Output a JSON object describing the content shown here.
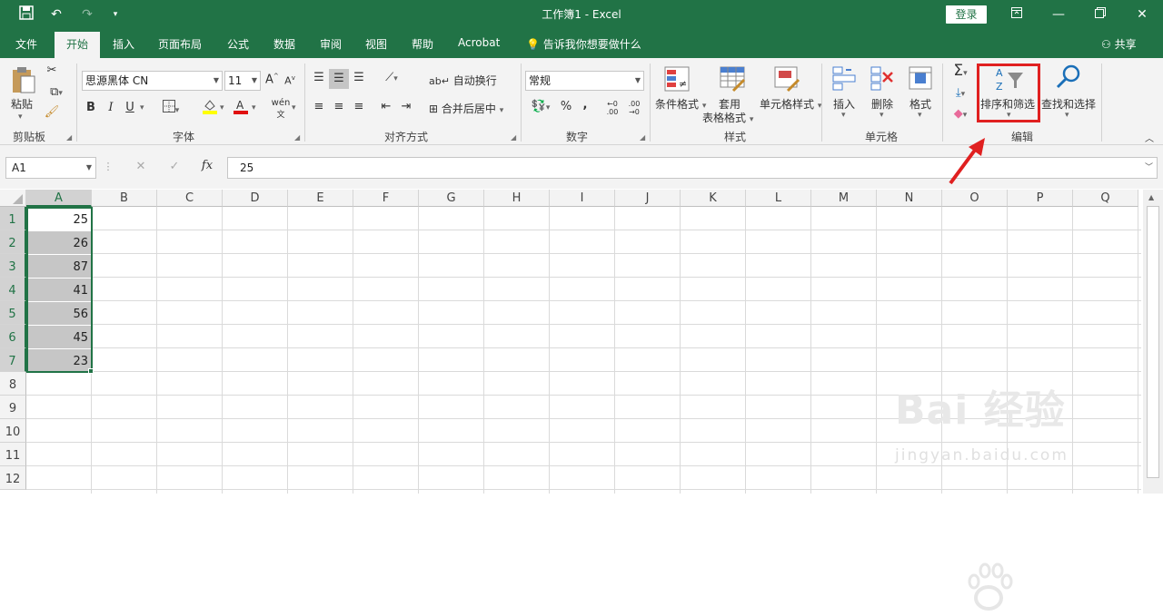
{
  "title": "工作簿1  -  Excel",
  "login": "登录",
  "qat": {
    "undo": "↶",
    "redo": "↷"
  },
  "tabs": [
    "文件",
    "开始",
    "插入",
    "页面布局",
    "公式",
    "数据",
    "审阅",
    "视图",
    "帮助",
    "Acrobat"
  ],
  "tell_me": "告诉我你想要做什么",
  "share": "共享",
  "clipboard": {
    "paste": "粘贴",
    "group": "剪贴板"
  },
  "font": {
    "name": "思源黑体 CN",
    "size": "11",
    "bold": "B",
    "italic": "I",
    "underline": "U",
    "group": "字体"
  },
  "alignment": {
    "wrap": "自动换行",
    "merge": "合并后居中",
    "group": "对齐方式"
  },
  "number": {
    "format": "常规",
    "percent": "%",
    "comma": ",",
    "group": "数字"
  },
  "styles": {
    "conditional": "条件格式",
    "table_line1": "套用",
    "table_line2": "表格格式",
    "cell_styles": "单元格样式",
    "group": "样式"
  },
  "cells": {
    "insert": "插入",
    "delete": "删除",
    "format": "格式",
    "group": "单元格"
  },
  "editing": {
    "sigma": "Σ",
    "sort_filter": "排序和筛选",
    "find_select": "查找和选择",
    "group": "编辑"
  },
  "formula": {
    "name_box": "A1",
    "fx": "fx",
    "value": "25"
  },
  "columns": [
    "A",
    "B",
    "C",
    "D",
    "E",
    "F",
    "G",
    "H",
    "I",
    "J",
    "K",
    "L",
    "M",
    "N",
    "O",
    "P",
    "Q"
  ],
  "rows": [
    "1",
    "2",
    "3",
    "4",
    "5",
    "6",
    "7",
    "8",
    "9",
    "10",
    "11",
    "12"
  ],
  "column_a_values": [
    "25",
    "26",
    "87",
    "41",
    "56",
    "45",
    "23"
  ],
  "watermark": {
    "main": "Bai 经验",
    "sub": "jingyan.baidu.com"
  },
  "colors": {
    "brand": "#217346",
    "highlight": "#e02020"
  }
}
